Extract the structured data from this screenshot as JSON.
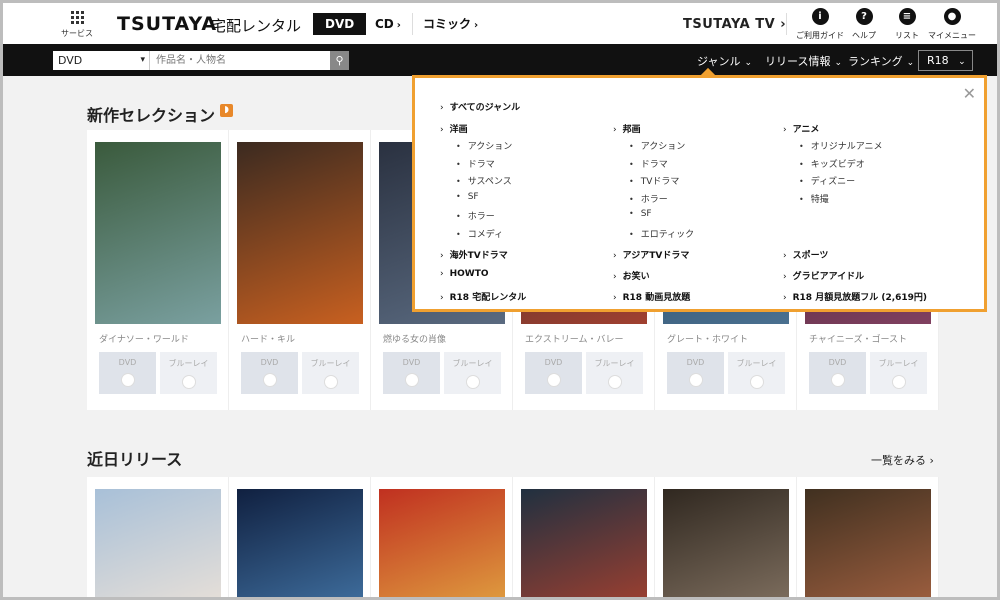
{
  "header": {
    "service_label": "サービス",
    "logo": "TSUTAYA",
    "logo_sub": "宅配レンタル",
    "tabs": [
      {
        "label": "DVD"
      },
      {
        "label": "CD"
      },
      {
        "label": "コミック"
      }
    ],
    "tv_link": "TSUTAYA TV",
    "icons": [
      {
        "label": "ご利用ガイド",
        "icon": "guide-icon"
      },
      {
        "label": "ヘルプ",
        "icon": "help-icon"
      },
      {
        "label": "リスト",
        "icon": "list-icon"
      },
      {
        "label": "マイメニュー",
        "icon": "user-icon"
      }
    ]
  },
  "searchbar": {
    "category": "DVD",
    "placeholder": "作品名・人物名",
    "nav": [
      {
        "label": "ジャンル"
      },
      {
        "label": "リリース情報"
      },
      {
        "label": "ランキング"
      }
    ],
    "r18": "R18"
  },
  "sections": {
    "new_title": "新作セレクション",
    "upcoming_title": "近日リリース",
    "more_link": "一覧をみる"
  },
  "new_releases": [
    {
      "title": "ダイナソー・ワールド",
      "colors": [
        "#3a5a3c",
        "#7aa0a0"
      ]
    },
    {
      "title": "ハード・キル",
      "colors": [
        "#3b2a20",
        "#c86020"
      ]
    },
    {
      "title": "燃ゆる女の肖像",
      "colors": [
        "#2a3140",
        "#5a6a80"
      ]
    },
    {
      "title": "エクストリーム・バレー",
      "colors": [
        "#3a2a2a",
        "#a04030"
      ]
    },
    {
      "title": "グレート・ホワイト",
      "colors": [
        "#20405a",
        "#4a7090"
      ]
    },
    {
      "title": "チャイニーズ・ゴースト",
      "colors": [
        "#402030",
        "#804060"
      ]
    }
  ],
  "format_buttons": {
    "dvd": "DVD",
    "bluray": "ブルーレイ"
  },
  "upcoming": [
    {
      "colors": [
        "#a8c0d8",
        "#e8e0d8"
      ]
    },
    {
      "colors": [
        "#102040",
        "#4070a0"
      ]
    },
    {
      "colors": [
        "#c03020",
        "#e0a040"
      ]
    },
    {
      "colors": [
        "#203040",
        "#a04030"
      ]
    },
    {
      "colors": [
        "#302820",
        "#807060"
      ]
    },
    {
      "colors": [
        "#403020",
        "#a06040"
      ]
    }
  ],
  "genre_menu": {
    "all": "すべてのジャンル",
    "columns": [
      {
        "head": "洋画",
        "items": [
          "アクション",
          "ドラマ",
          "サスペンス",
          "SF",
          "ホラー",
          "コメディ"
        ]
      },
      {
        "head": "邦画",
        "items": [
          "アクション",
          "ドラマ",
          "TVドラマ",
          "ホラー",
          "SF",
          "エロティック"
        ]
      },
      {
        "head": "アニメ",
        "items": [
          "オリジナルアニメ",
          "キッズビデオ",
          "ディズニー",
          "特撮"
        ]
      }
    ],
    "extra": [
      [
        "海外TVドラマ",
        "アジアTVドラマ",
        "スポーツ"
      ],
      [
        "HOWTO",
        "お笑い",
        "グラビアアイドル"
      ],
      [
        "R18 宅配レンタル",
        "R18 動画見放題",
        "R18 月額見放題フル (2,619円)"
      ]
    ]
  }
}
